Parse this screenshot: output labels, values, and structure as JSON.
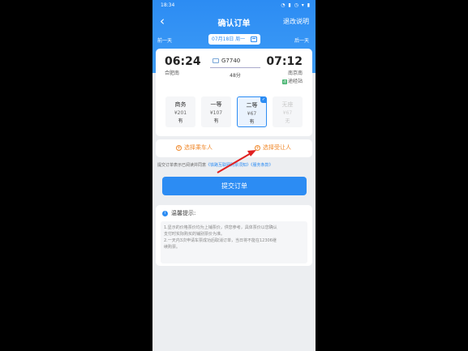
{
  "status": {
    "time": "18:34",
    "icons": "◔ ▮ ◷ ▾ ▮"
  },
  "nav": {
    "back_icon": "‹",
    "title": "确认订单",
    "refund": "退改说明"
  },
  "datebar": {
    "prev": "前一天",
    "date": "07月18日 周一",
    "next": "后一天"
  },
  "train": {
    "dep_time": "06:24",
    "dep_station": "合肥南",
    "number": "G7740",
    "duration": "48分",
    "arr_time": "07:12",
    "arr_station": "南京南",
    "via_badge": "途",
    "via": "途经站"
  },
  "seats": [
    {
      "name": "商务",
      "price": "¥201",
      "avail": "有"
    },
    {
      "name": "一等",
      "price": "¥107",
      "avail": "有"
    },
    {
      "name": "二等",
      "price": "¥67",
      "avail": "有"
    },
    {
      "name": "无座",
      "price": "¥67",
      "avail": "无"
    }
  ],
  "selected_check": "✓",
  "passengers": {
    "plus": "+",
    "choose_passenger": "选择乘车人",
    "choose_transferee": "选择受让人"
  },
  "agreement": {
    "prefix": "提交订单表示已阅读并同意",
    "link1": "《铁路互联网购票须知》",
    "link2": "《服务条款》"
  },
  "submit": "提交订单",
  "tips": {
    "icon": "i",
    "title": "温馨提示:",
    "lines": [
      "1.显示的价格票价均为上铺票价，供您参考，具体票价以您确认",
      "支付时实际购买的铺别票价为准。",
      "2.一天内3次申请车票成功后取消订单，当日将不能在12306继",
      "续购票。"
    ]
  },
  "colors": {
    "primary": "#2c8cf3",
    "orange": "#f08a2e",
    "annotation": "#e02020"
  }
}
